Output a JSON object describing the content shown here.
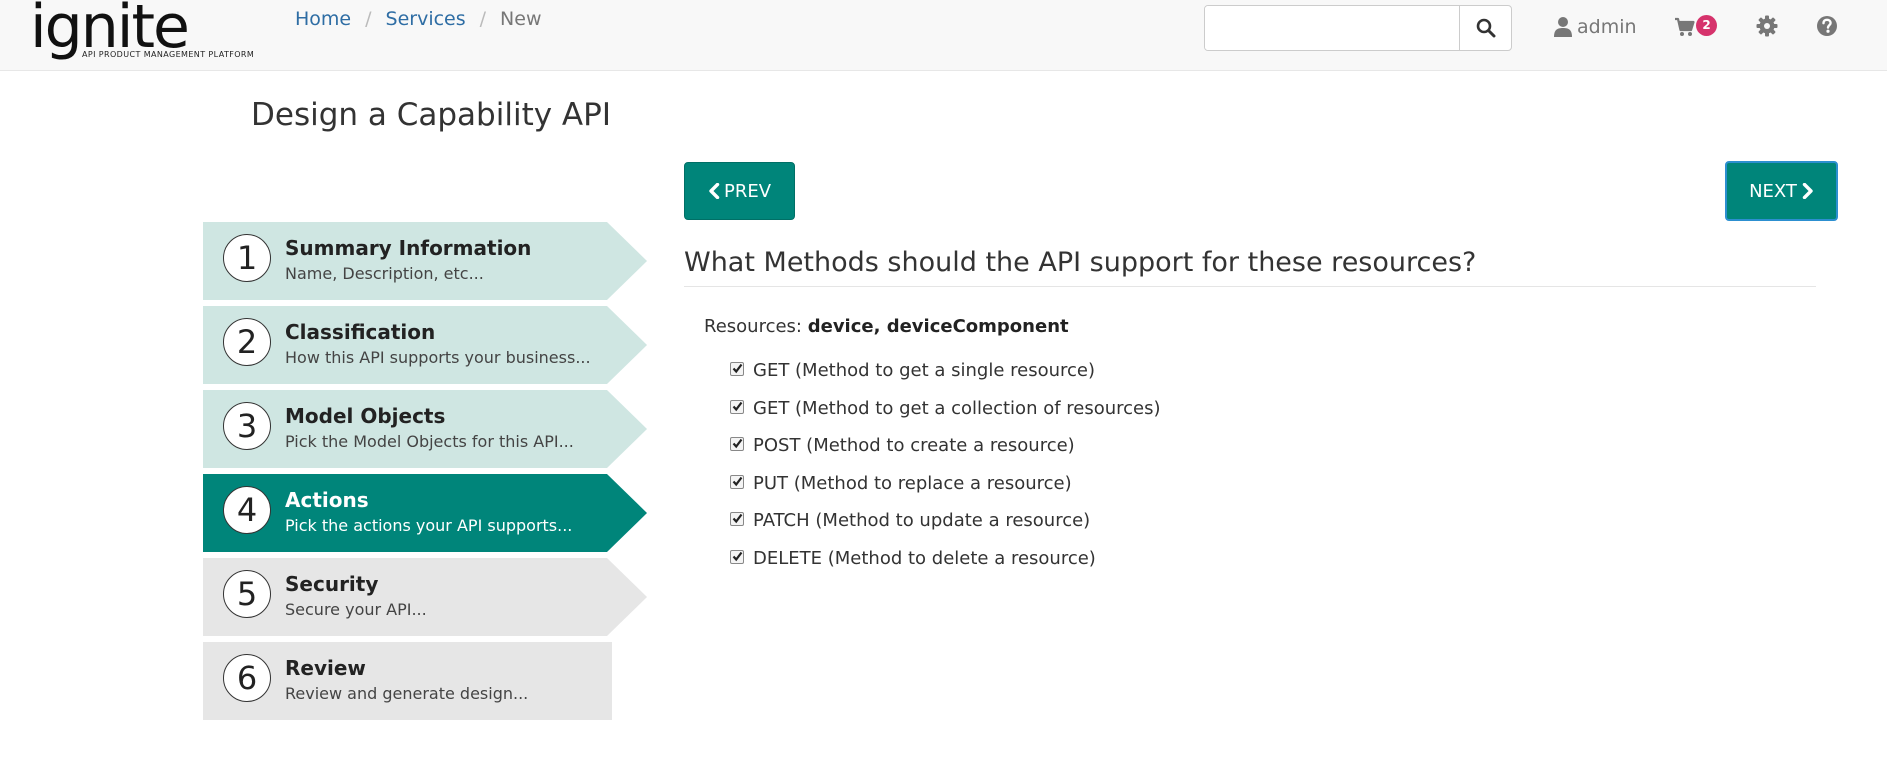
{
  "header": {
    "logo_text": "ignite",
    "logo_tagline": "API PRODUCT MANAGEMENT PLATFORM",
    "breadcrumb": [
      {
        "label": "Home"
      },
      {
        "label": "Services"
      },
      {
        "label": "New"
      }
    ],
    "search": {
      "value": "",
      "placeholder": "",
      "icon": "search-icon"
    },
    "user": {
      "label": "admin",
      "icon": "user-icon"
    },
    "cart": {
      "count": "2",
      "icon": "cart-icon"
    },
    "settings_icon": "gear-icon",
    "help_icon": "question-circle-icon"
  },
  "page": {
    "title": "Design a Capability API"
  },
  "wizard": {
    "steps": [
      {
        "number": "1",
        "title": "Summary Information",
        "subtitle": "Name, Description, etc...",
        "state": "done"
      },
      {
        "number": "2",
        "title": "Classification",
        "subtitle": "How this API supports your business...",
        "state": "done"
      },
      {
        "number": "3",
        "title": "Model Objects",
        "subtitle": "Pick the Model Objects for this API...",
        "state": "done"
      },
      {
        "number": "4",
        "title": "Actions",
        "subtitle": "Pick the actions your API supports...",
        "state": "active"
      },
      {
        "number": "5",
        "title": "Security",
        "subtitle": "Secure your API...",
        "state": "todo"
      },
      {
        "number": "6",
        "title": "Review",
        "subtitle": "Review and generate design...",
        "state": "todo"
      }
    ]
  },
  "nav": {
    "prev_label": "PREV",
    "next_label": "NEXT"
  },
  "content": {
    "question": "What Methods should the API support for these resources?",
    "resources_label": "Resources:",
    "resources_value": "device, deviceComponent",
    "methods": [
      {
        "label": "GET (Method to get a single resource)",
        "checked": true
      },
      {
        "label": "GET (Method to get a collection of resources)",
        "checked": true
      },
      {
        "label": "POST (Method to create a resource)",
        "checked": true
      },
      {
        "label": "PUT (Method to replace a resource)",
        "checked": true
      },
      {
        "label": "PATCH (Method to update a resource)",
        "checked": true
      },
      {
        "label": "DELETE (Method to delete a resource)",
        "checked": true
      }
    ]
  },
  "colors": {
    "accent": "#00857a",
    "step_done": "#cfe6e2",
    "step_todo": "#e6e6e6",
    "badge": "#d6336c",
    "link": "#2e6da4"
  }
}
